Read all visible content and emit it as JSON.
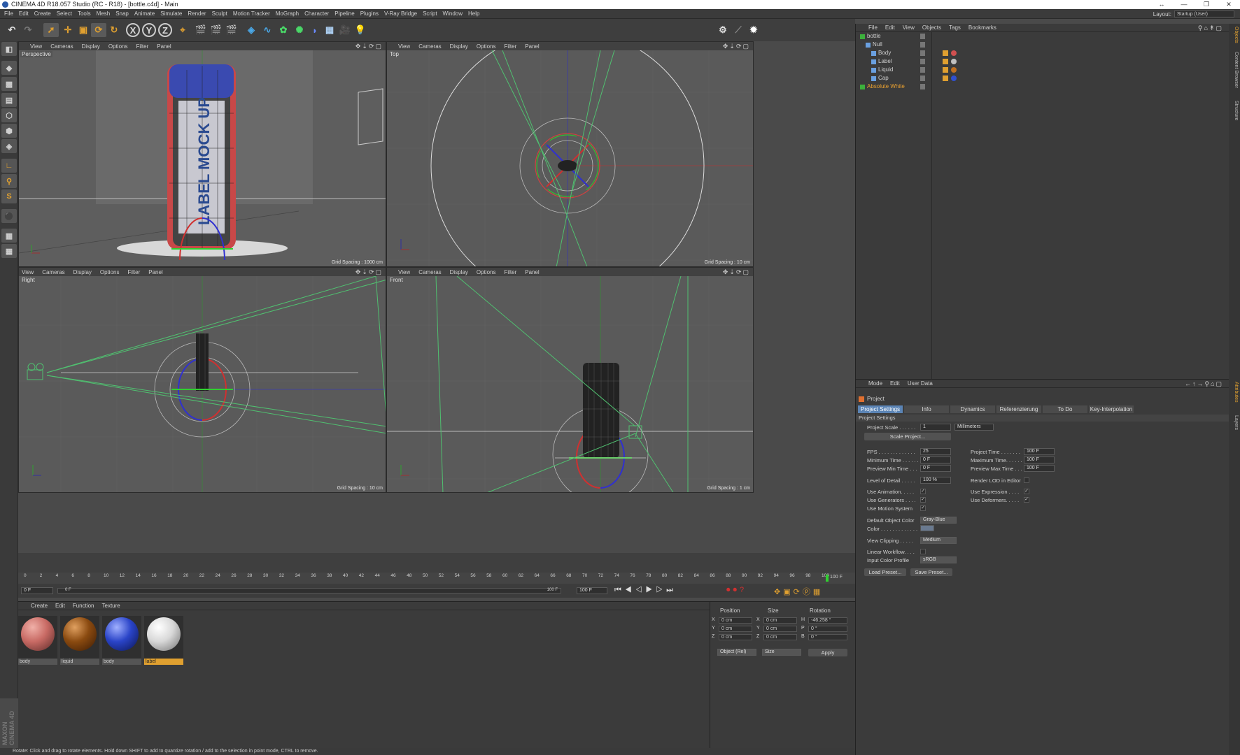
{
  "window": {
    "title": "CINEMA 4D R18.057 Studio (RC - R18) - [bottle.c4d] - Main",
    "controls": [
      "↔",
      "—",
      "❐",
      "✕"
    ]
  },
  "menu": [
    "File",
    "Edit",
    "Create",
    "Select",
    "Tools",
    "Mesh",
    "Snap",
    "Animate",
    "Simulate",
    "Render",
    "Sculpt",
    "Motion Tracker",
    "MoGraph",
    "Character",
    "Pipeline",
    "Plugins",
    "V-Ray Bridge",
    "Script",
    "Window",
    "Help"
  ],
  "layout": {
    "label": "Layout:",
    "value": "Startup (User)"
  },
  "toolbar": {
    "axis_x": "X",
    "axis_y": "Y",
    "axis_z": "Z"
  },
  "viewport_menu": [
    "View",
    "Cameras",
    "Display",
    "Options",
    "Filter",
    "Panel"
  ],
  "viewports": [
    {
      "name": "Perspective",
      "grid": "Grid Spacing : 1000 cm",
      "label_text": "LABEL MOCK UP"
    },
    {
      "name": "Top",
      "grid": "Grid Spacing : 10 cm"
    },
    {
      "name": "Right",
      "grid": "Grid Spacing : 10 cm"
    },
    {
      "name": "Front",
      "grid": "Grid Spacing : 1 cm"
    }
  ],
  "object_manager": {
    "menu": [
      "File",
      "Edit",
      "View",
      "Objects",
      "Tags",
      "Bookmarks"
    ],
    "objects": [
      {
        "name": "bottle",
        "indent": 0,
        "highlight": false
      },
      {
        "name": "Null",
        "indent": 1,
        "highlight": false
      },
      {
        "name": "Body",
        "indent": 2,
        "highlight": false,
        "tag_color": "#d05050"
      },
      {
        "name": "Label",
        "indent": 2,
        "highlight": false,
        "tag_color": "#c0c0c0"
      },
      {
        "name": "Liquid",
        "indent": 2,
        "highlight": false,
        "tag_color": "#c07020"
      },
      {
        "name": "Cap",
        "indent": 2,
        "highlight": false,
        "tag_color": "#3050d0"
      },
      {
        "name": "Absolute White",
        "indent": 0,
        "highlight": true
      }
    ]
  },
  "attributes": {
    "menu": [
      "Mode",
      "Edit",
      "User Data"
    ],
    "header": "Project",
    "tabs": [
      "Project Settings",
      "Info",
      "Dynamics",
      "Referenzierung",
      "To Do",
      "Key-Interpolation"
    ],
    "section": "Project Settings",
    "project_scale_label": "Project Scale . . . . . .",
    "project_scale_value": "1",
    "project_scale_unit": "Millimeters",
    "scale_button": "Scale Project...",
    "fps_label": "FPS . . . . . . . . . . . . .",
    "fps_value": "25",
    "project_time_label": "Project Time . . . . . . .",
    "project_time_value": "100 F",
    "min_time_label": "Minimum Time . . . . . .",
    "min_time_value": "0 F",
    "max_time_label": "Maximum Time. . . . . .",
    "max_time_value": "100 F",
    "prev_min_label": "Preview Min Time . . .",
    "prev_min_value": "0 F",
    "prev_max_label": "Preview Max Time . . .",
    "prev_max_value": "100 F",
    "lod_label": "Level of Detail . . . . .",
    "lod_value": "100 %",
    "render_lod_label": "Render LOD in Editor",
    "use_animation": "Use Animation. . . . .",
    "use_expression": "Use Expression . . . .",
    "use_generators": "Use Generators . . . .",
    "use_deformers": "Use Deformers. . . . .",
    "use_motion": "Use Motion System",
    "default_color_label": "Default Object Color",
    "default_color_value": "Gray-Blue",
    "color_label": "Color . . . . . . . . . . . . .",
    "view_clipping_label": "View Clipping . . . . .",
    "view_clipping_value": "Medium",
    "linear_workflow_label": "Linear Workflow. . . .",
    "input_color_label": "Input Color Profile",
    "input_color_value": "sRGB",
    "load_preset": "Load Preset...",
    "save_preset": "Save Preset..."
  },
  "right_tabs": [
    "Objects",
    "Content Browser",
    "Structure",
    "Attributes",
    "Layers"
  ],
  "timeline": {
    "ticks": [
      "0",
      "2",
      "4",
      "6",
      "8",
      "10",
      "12",
      "14",
      "16",
      "18",
      "20",
      "22",
      "24",
      "26",
      "28",
      "30",
      "32",
      "34",
      "36",
      "38",
      "40",
      "42",
      "44",
      "46",
      "48",
      "50",
      "52",
      "54",
      "56",
      "58",
      "60",
      "62",
      "64",
      "66",
      "68",
      "70",
      "72",
      "74",
      "76",
      "78",
      "80",
      "82",
      "84",
      "86",
      "88",
      "90",
      "92",
      "94",
      "96",
      "98",
      "100"
    ],
    "end_frame": "100 F",
    "current": "0 F",
    "slider_start": "0 F",
    "slider_end": "100 F",
    "end_field": "100 F"
  },
  "material_manager": {
    "menu": [
      "Create",
      "Edit",
      "Function",
      "Texture"
    ],
    "materials": [
      {
        "name": "body",
        "color": "#c86a64",
        "selected": false
      },
      {
        "name": "liquid",
        "color": "#8a4a10",
        "selected": false
      },
      {
        "name": "body",
        "color": "#2a44c8",
        "selected": false
      },
      {
        "name": "label",
        "color": "#d8d8d8",
        "selected": true
      }
    ]
  },
  "coordinates": {
    "headers": [
      "Position",
      "Size",
      "Rotation"
    ],
    "rows": [
      {
        "axis": "X",
        "pos": "0 cm",
        "size_axis": "X",
        "size": "0 cm",
        "rot_axis": "H",
        "rot": "-46.258 °"
      },
      {
        "axis": "Y",
        "pos": "0 cm",
        "size_axis": "Y",
        "size": "0 cm",
        "rot_axis": "P",
        "rot": "0 °"
      },
      {
        "axis": "Z",
        "pos": "0 cm",
        "size_axis": "Z",
        "size": "0 cm",
        "rot_axis": "B",
        "rot": "0 °"
      }
    ],
    "mode": "Object (Rel)",
    "size_mode": "Size",
    "apply": "Apply"
  },
  "status": "Rotate: Click and drag to rotate elements. Hold down SHIFT to add to quantize rotation / add to the selection in point mode, CTRL to remove.",
  "logo": "MAXON CINEMA 4D"
}
